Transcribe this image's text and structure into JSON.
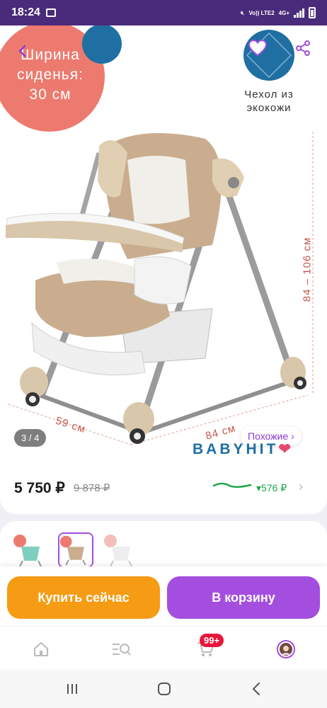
{
  "status_bar": {
    "time": "18:24",
    "network_text": "Vo)) LTE2",
    "network_text_2": "4G+"
  },
  "product_image": {
    "seat_width_label": "Ширина сиденья: 30 см",
    "cover_label": "Чехол из экокожи",
    "width_dim": "59 см",
    "depth_dim": "84 см",
    "height_dim": "84 – 106 см",
    "pager": "3 / 4",
    "similar_button": "Похожие ›",
    "brand": "BABYHIT"
  },
  "price": {
    "current": "5 750 ₽",
    "old": "9 878 ₽",
    "discount": "▾576 ₽"
  },
  "actions": {
    "buy_now": "Купить сейчас",
    "add_to_cart": "В корзину"
  },
  "tabbar": {
    "cart_badge": "99+"
  },
  "colors": {
    "accent_purple": "#a44ee0",
    "buy_orange": "#f59b14",
    "discount_green": "#1fa64a",
    "status_bar": "#4a2a7a"
  }
}
